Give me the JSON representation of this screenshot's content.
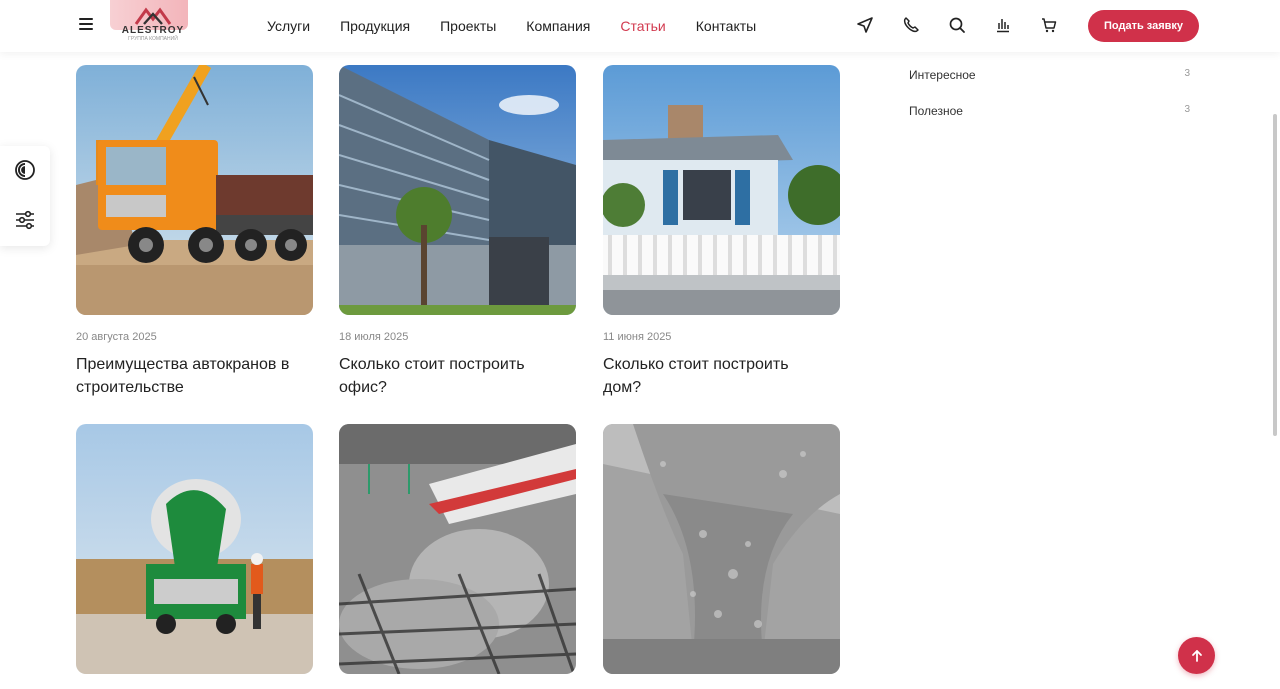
{
  "header": {
    "logo_text": "ALESTROY",
    "logo_sub": "ГРУППА КОМПАНИЙ",
    "nav": [
      {
        "label": "Услуги"
      },
      {
        "label": "Продукция"
      },
      {
        "label": "Проекты"
      },
      {
        "label": "Компания"
      },
      {
        "label": "Статьи",
        "active": true
      },
      {
        "label": "Контакты"
      }
    ],
    "icons": [
      "location-arrow-icon",
      "phone-icon",
      "search-icon",
      "compare-chart-icon",
      "cart-icon"
    ],
    "cta_label": "Подать заявку"
  },
  "side_widget": {
    "icons": [
      "contrast-icon",
      "sliders-icon"
    ]
  },
  "articles": [
    {
      "date": "20 августа 2025",
      "title": "Преимущества автокранов в строительстве",
      "image": "truck-crane"
    },
    {
      "date": "18 июля 2025",
      "title": "Сколько стоит построить офис?",
      "image": "office-building"
    },
    {
      "date": "11 июня 2025",
      "title": "Сколько стоит построить дом?",
      "image": "house-fence"
    },
    {
      "date": "",
      "title": "",
      "image": "concrete-mixer-truck"
    },
    {
      "date": "",
      "title": "",
      "image": "concrete-pouring-rebar"
    },
    {
      "date": "",
      "title": "",
      "image": "concrete-flow"
    }
  ],
  "categories": [
    {
      "label": "Интересное",
      "count": "3"
    },
    {
      "label": "Полезное",
      "count": "3"
    }
  ],
  "colors": {
    "accent": "#d0314a",
    "active_nav": "#d23a4f"
  }
}
